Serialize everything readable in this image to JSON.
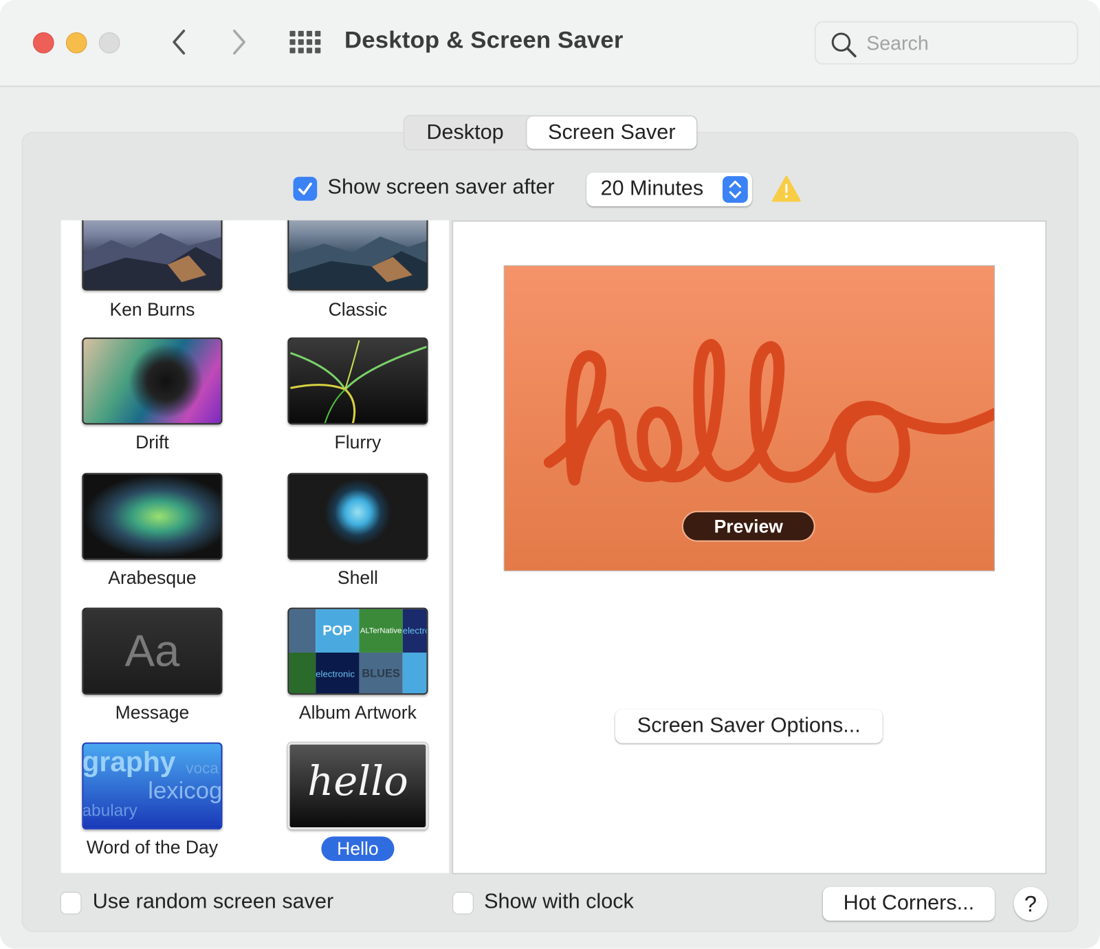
{
  "window": {
    "title": "Desktop & Screen Saver",
    "search_placeholder": "Search"
  },
  "tabs": [
    {
      "label": "Desktop",
      "selected": false
    },
    {
      "label": "Screen Saver",
      "selected": true
    }
  ],
  "show_after": {
    "label": "Show screen saver after",
    "checked": true,
    "value": "20 Minutes"
  },
  "screen_savers": [
    {
      "name": "Ken Burns",
      "selected": false
    },
    {
      "name": "Classic",
      "selected": false
    },
    {
      "name": "Drift",
      "selected": false
    },
    {
      "name": "Flurry",
      "selected": false
    },
    {
      "name": "Arabesque",
      "selected": false
    },
    {
      "name": "Shell",
      "selected": false
    },
    {
      "name": "Message",
      "selected": false
    },
    {
      "name": "Album Artwork",
      "selected": false
    },
    {
      "name": "Word of the Day",
      "selected": false
    },
    {
      "name": "Hello",
      "selected": true
    }
  ],
  "thumb_text": {
    "message": "Aa",
    "hello": "hello",
    "word1": "graphy",
    "word2": "voca",
    "word3": "lexicog",
    "word4": "abulary",
    "album": [
      "BLUES",
      "POP",
      "ALTerNative",
      "electronic"
    ]
  },
  "preview": {
    "text": "hello",
    "button": "Preview",
    "bg_color": "#f0875a",
    "stroke_color": "#d9491f"
  },
  "options_button": "Screen Saver Options...",
  "footer": {
    "random_label": "Use random screen saver",
    "random_checked": false,
    "clock_label": "Show with clock",
    "clock_checked": false,
    "hot_corners": "Hot Corners...",
    "help": "?"
  },
  "colors": {
    "accent": "#3a82f6",
    "selection": "#2f6ce0",
    "warning": "#f8cd46"
  }
}
